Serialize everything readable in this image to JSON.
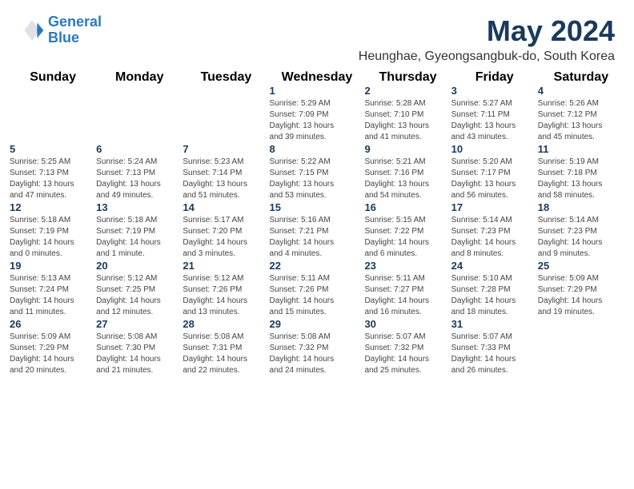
{
  "header": {
    "logo_line1": "General",
    "logo_line2": "Blue",
    "month_title": "May 2024",
    "subtitle": "Heunghae, Gyeongsangbuk-do, South Korea"
  },
  "days_of_week": [
    "Sunday",
    "Monday",
    "Tuesday",
    "Wednesday",
    "Thursday",
    "Friday",
    "Saturday"
  ],
  "weeks": [
    [
      {
        "day": "",
        "info": ""
      },
      {
        "day": "",
        "info": ""
      },
      {
        "day": "",
        "info": ""
      },
      {
        "day": "1",
        "info": "Sunrise: 5:29 AM\nSunset: 7:09 PM\nDaylight: 13 hours\nand 39 minutes."
      },
      {
        "day": "2",
        "info": "Sunrise: 5:28 AM\nSunset: 7:10 PM\nDaylight: 13 hours\nand 41 minutes."
      },
      {
        "day": "3",
        "info": "Sunrise: 5:27 AM\nSunset: 7:11 PM\nDaylight: 13 hours\nand 43 minutes."
      },
      {
        "day": "4",
        "info": "Sunrise: 5:26 AM\nSunset: 7:12 PM\nDaylight: 13 hours\nand 45 minutes."
      }
    ],
    [
      {
        "day": "5",
        "info": "Sunrise: 5:25 AM\nSunset: 7:13 PM\nDaylight: 13 hours\nand 47 minutes."
      },
      {
        "day": "6",
        "info": "Sunrise: 5:24 AM\nSunset: 7:13 PM\nDaylight: 13 hours\nand 49 minutes."
      },
      {
        "day": "7",
        "info": "Sunrise: 5:23 AM\nSunset: 7:14 PM\nDaylight: 13 hours\nand 51 minutes."
      },
      {
        "day": "8",
        "info": "Sunrise: 5:22 AM\nSunset: 7:15 PM\nDaylight: 13 hours\nand 53 minutes."
      },
      {
        "day": "9",
        "info": "Sunrise: 5:21 AM\nSunset: 7:16 PM\nDaylight: 13 hours\nand 54 minutes."
      },
      {
        "day": "10",
        "info": "Sunrise: 5:20 AM\nSunset: 7:17 PM\nDaylight: 13 hours\nand 56 minutes."
      },
      {
        "day": "11",
        "info": "Sunrise: 5:19 AM\nSunset: 7:18 PM\nDaylight: 13 hours\nand 58 minutes."
      }
    ],
    [
      {
        "day": "12",
        "info": "Sunrise: 5:18 AM\nSunset: 7:19 PM\nDaylight: 14 hours\nand 0 minutes."
      },
      {
        "day": "13",
        "info": "Sunrise: 5:18 AM\nSunset: 7:19 PM\nDaylight: 14 hours\nand 1 minute."
      },
      {
        "day": "14",
        "info": "Sunrise: 5:17 AM\nSunset: 7:20 PM\nDaylight: 14 hours\nand 3 minutes."
      },
      {
        "day": "15",
        "info": "Sunrise: 5:16 AM\nSunset: 7:21 PM\nDaylight: 14 hours\nand 4 minutes."
      },
      {
        "day": "16",
        "info": "Sunrise: 5:15 AM\nSunset: 7:22 PM\nDaylight: 14 hours\nand 6 minutes."
      },
      {
        "day": "17",
        "info": "Sunrise: 5:14 AM\nSunset: 7:23 PM\nDaylight: 14 hours\nand 8 minutes."
      },
      {
        "day": "18",
        "info": "Sunrise: 5:14 AM\nSunset: 7:23 PM\nDaylight: 14 hours\nand 9 minutes."
      }
    ],
    [
      {
        "day": "19",
        "info": "Sunrise: 5:13 AM\nSunset: 7:24 PM\nDaylight: 14 hours\nand 11 minutes."
      },
      {
        "day": "20",
        "info": "Sunrise: 5:12 AM\nSunset: 7:25 PM\nDaylight: 14 hours\nand 12 minutes."
      },
      {
        "day": "21",
        "info": "Sunrise: 5:12 AM\nSunset: 7:26 PM\nDaylight: 14 hours\nand 13 minutes."
      },
      {
        "day": "22",
        "info": "Sunrise: 5:11 AM\nSunset: 7:26 PM\nDaylight: 14 hours\nand 15 minutes."
      },
      {
        "day": "23",
        "info": "Sunrise: 5:11 AM\nSunset: 7:27 PM\nDaylight: 14 hours\nand 16 minutes."
      },
      {
        "day": "24",
        "info": "Sunrise: 5:10 AM\nSunset: 7:28 PM\nDaylight: 14 hours\nand 18 minutes."
      },
      {
        "day": "25",
        "info": "Sunrise: 5:09 AM\nSunset: 7:29 PM\nDaylight: 14 hours\nand 19 minutes."
      }
    ],
    [
      {
        "day": "26",
        "info": "Sunrise: 5:09 AM\nSunset: 7:29 PM\nDaylight: 14 hours\nand 20 minutes."
      },
      {
        "day": "27",
        "info": "Sunrise: 5:08 AM\nSunset: 7:30 PM\nDaylight: 14 hours\nand 21 minutes."
      },
      {
        "day": "28",
        "info": "Sunrise: 5:08 AM\nSunset: 7:31 PM\nDaylight: 14 hours\nand 22 minutes."
      },
      {
        "day": "29",
        "info": "Sunrise: 5:08 AM\nSunset: 7:32 PM\nDaylight: 14 hours\nand 24 minutes."
      },
      {
        "day": "30",
        "info": "Sunrise: 5:07 AM\nSunset: 7:32 PM\nDaylight: 14 hours\nand 25 minutes."
      },
      {
        "day": "31",
        "info": "Sunrise: 5:07 AM\nSunset: 7:33 PM\nDaylight: 14 hours\nand 26 minutes."
      },
      {
        "day": "",
        "info": ""
      }
    ]
  ]
}
